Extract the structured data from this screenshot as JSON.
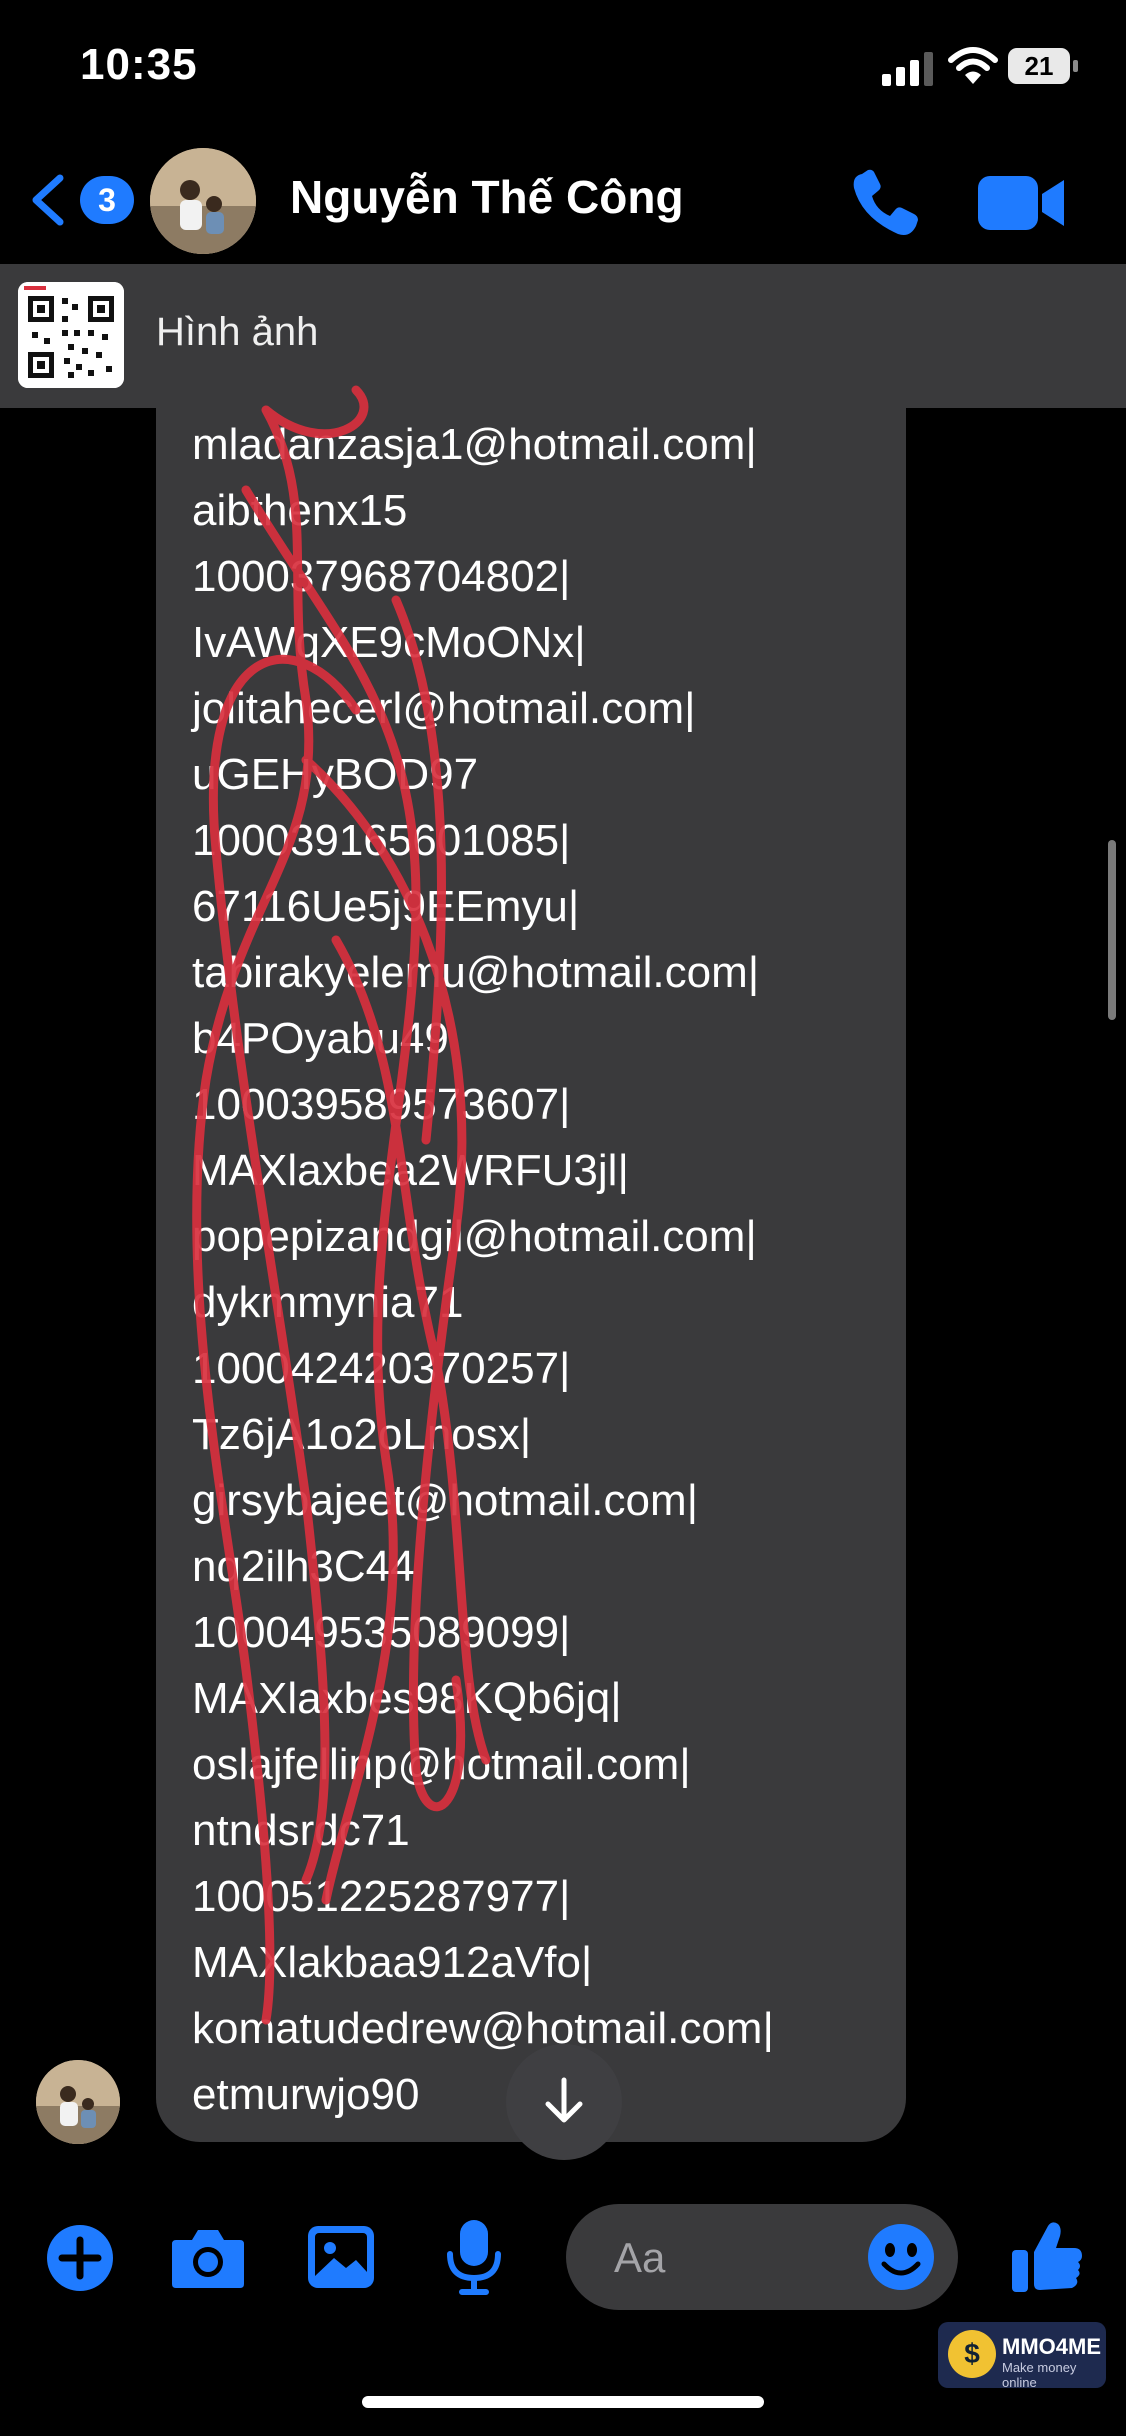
{
  "status_bar": {
    "time": "10:35",
    "battery": "21"
  },
  "header": {
    "back_badge": "3",
    "contact_name": "Nguyễn Thế Công",
    "icons": [
      "chevron-left-icon",
      "phone-icon",
      "video-camera-icon"
    ]
  },
  "pinned": {
    "label": "Hình ảnh",
    "thumbnail_icon": "qr-code-icon"
  },
  "message": {
    "lines": [
      "mladanzasja1@hotmail.com|",
      "aibthenx15",
      "100037968704802|",
      "IvAWqXE9cMoONx|",
      "jolitahecerl@hotmail.com|",
      "uGEHyBOD97",
      "100039165601085|",
      "67116Ue5j9EEmyu|",
      "tabirakyelemu@hotmail.com|",
      "b4POyabu49",
      "100039589573607|",
      "MAXlaxbea2WRFU3jl|",
      "popepizandgil@hotmail.com|",
      "dykmmynia71",
      "100042420370257|",
      "Tz6jA1o2oLnosx|",
      "girsybajeet@hotmail.com|",
      "nq2ilh3C44",
      "100049535089099|",
      "MAXlaxbes98KQb6jq|",
      "oslajfellinp@hotmail.com|",
      "ntndsrdc71",
      "100051225287977|",
      "MAXlakbaa912aVfo|",
      "komatudedrew@hotmail.com|",
      "etmurwjo90"
    ]
  },
  "composer": {
    "placeholder": "Aa",
    "icons": [
      "plus-icon",
      "camera-icon",
      "image-icon",
      "microphone-icon",
      "emoji-icon",
      "thumbs-up-icon"
    ]
  },
  "watermark": {
    "name": "MMO4ME",
    "tagline": "Make money online"
  },
  "colors": {
    "accent": "#1f7bff",
    "bubble": "#3a3a3c",
    "scribble": "#d8303e"
  }
}
